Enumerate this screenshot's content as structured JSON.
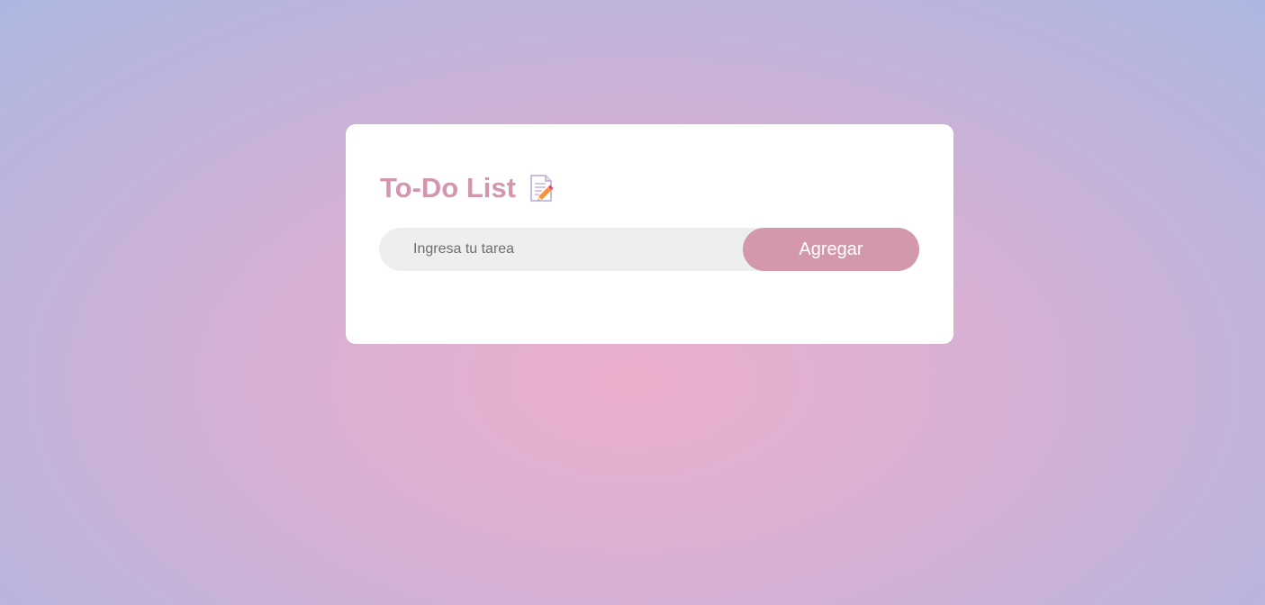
{
  "app": {
    "title": "To-Do List",
    "title_icon": "memo-icon"
  },
  "task_input": {
    "placeholder": "Ingresa tu tarea",
    "value": ""
  },
  "add_button": {
    "label": "Agregar"
  },
  "colors": {
    "accent": "#d398ac",
    "title": "#d495ae",
    "input_background": "#edeef0",
    "card_background": "#ffffff"
  },
  "tasks": []
}
